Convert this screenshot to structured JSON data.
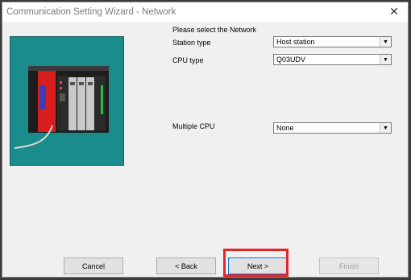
{
  "window": {
    "title": "Communication Setting Wizard - Network",
    "close_icon": "close-icon"
  },
  "form": {
    "heading": "Please select the Network",
    "station_type": {
      "label": "Station type",
      "value": "Host station"
    },
    "cpu_type": {
      "label": "CPU type",
      "value": "Q03UDV"
    },
    "multiple_cpu": {
      "label": "Multiple CPU",
      "value": "None"
    }
  },
  "buttons": {
    "cancel": "Cancel",
    "back": "< Back",
    "next": "Next >",
    "finish": "Finish"
  },
  "colors": {
    "highlight": "#e8232a",
    "panel": "#1a8c8c"
  }
}
